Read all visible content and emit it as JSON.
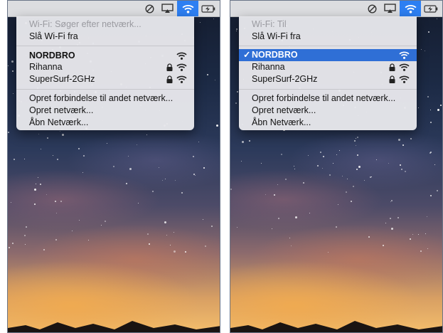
{
  "left_panel": {
    "status": "Wi-Fi: Søger efter netværk...",
    "toggle": "Slå Wi-Fi fra",
    "networks": [
      {
        "name": "NORDBRO",
        "locked": false
      },
      {
        "name": "Rihanna",
        "locked": true
      },
      {
        "name": "SuperSurf-2GHz",
        "locked": true
      }
    ],
    "actions": [
      "Opret forbindelse til andet netværk...",
      "Opret netværk...",
      "Åbn Netværk..."
    ]
  },
  "right_panel": {
    "status": "Wi-Fi: Til",
    "toggle": "Slå Wi-Fi fra",
    "selected_check": "✓",
    "networks": [
      {
        "name": "NORDBRO",
        "locked": false,
        "selected": true
      },
      {
        "name": "Rihanna",
        "locked": true
      },
      {
        "name": "SuperSurf-2GHz",
        "locked": true
      }
    ],
    "actions": [
      "Opret forbindelse til andet netværk...",
      "Opret netværk...",
      "Åbn Netværk..."
    ]
  },
  "menubar_icons": [
    "do-not-disturb-icon",
    "airplay-icon",
    "wifi-icon",
    "battery-charging-icon"
  ],
  "colors": {
    "highlight": "#2f6fd6",
    "menubar_active": "#2d7ff2"
  }
}
